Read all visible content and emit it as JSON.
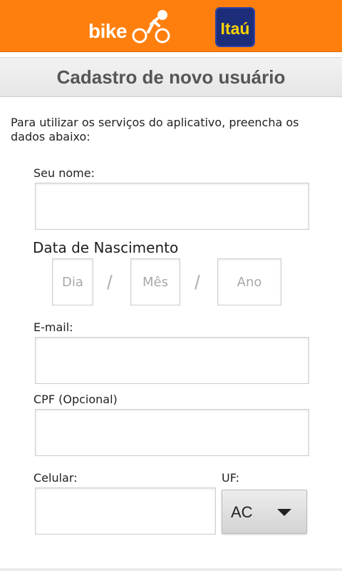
{
  "header": {
    "bikerio_logo_text": "bike",
    "itau_logo_text": "Itaú",
    "background_color": "#ff7f0e"
  },
  "title": "Cadastro de novo usuário",
  "intro": "Para utilizar os serviços do aplicativo, preencha os dados abaixo:",
  "form": {
    "name_label": "Seu nome:",
    "name_value": "",
    "birth_label": "Data de Nascimento",
    "day_placeholder": "Dia",
    "month_placeholder": "Mês",
    "year_placeholder": "Ano",
    "separator": "/",
    "email_label": "E-mail:",
    "email_value": "",
    "cpf_label": "CPF (Opcional)",
    "cpf_value": "",
    "phone_label": "Celular:",
    "phone_value": "",
    "uf_label": "UF:",
    "uf_value": "AC"
  }
}
